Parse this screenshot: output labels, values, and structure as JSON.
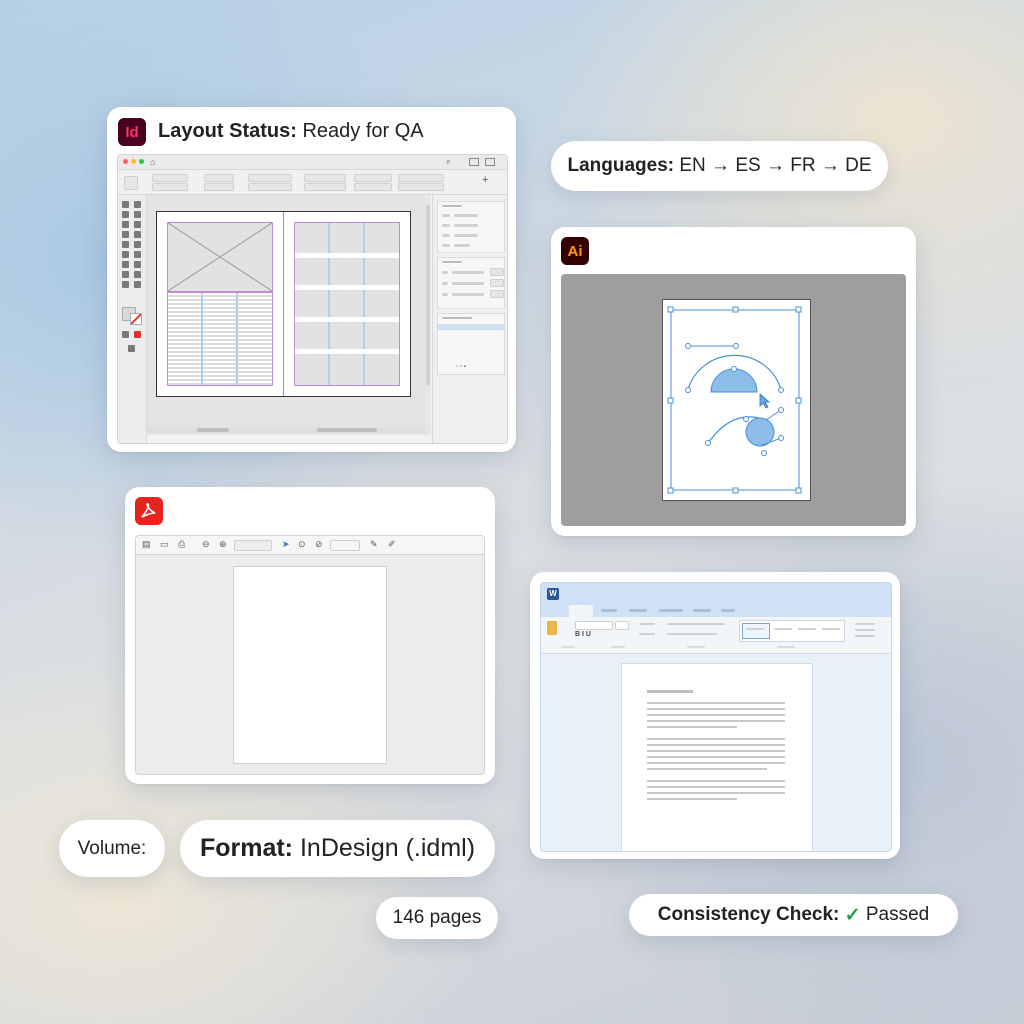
{
  "indesign": {
    "icon": "Id",
    "title_label": "Layout Status:",
    "title_value": "Ready for QA"
  },
  "illustrator": {
    "icon": "Ai"
  },
  "acrobat": {
    "icon": "pdf-icon"
  },
  "word": {
    "icon": "W"
  },
  "languages": {
    "label": "Languages:",
    "value": "EN → ES → FR → DE"
  },
  "volume": {
    "label": "Volume:"
  },
  "format": {
    "label": "Format:",
    "value": "InDesign (.idml)"
  },
  "pages": {
    "value": "146 pages"
  },
  "consistency": {
    "label": "Consistency Check:",
    "check": "✓",
    "value": "Passed"
  },
  "colors": {
    "indesign": "#49021f",
    "indesign_text": "#ff3366",
    "illustrator": "#330000",
    "illustrator_text": "#ff9a00",
    "acrobat": "#e5251d",
    "word_ribbon": "#cfe1f4",
    "accent_blue": "#4a90d9",
    "success": "#1e9e3a"
  }
}
